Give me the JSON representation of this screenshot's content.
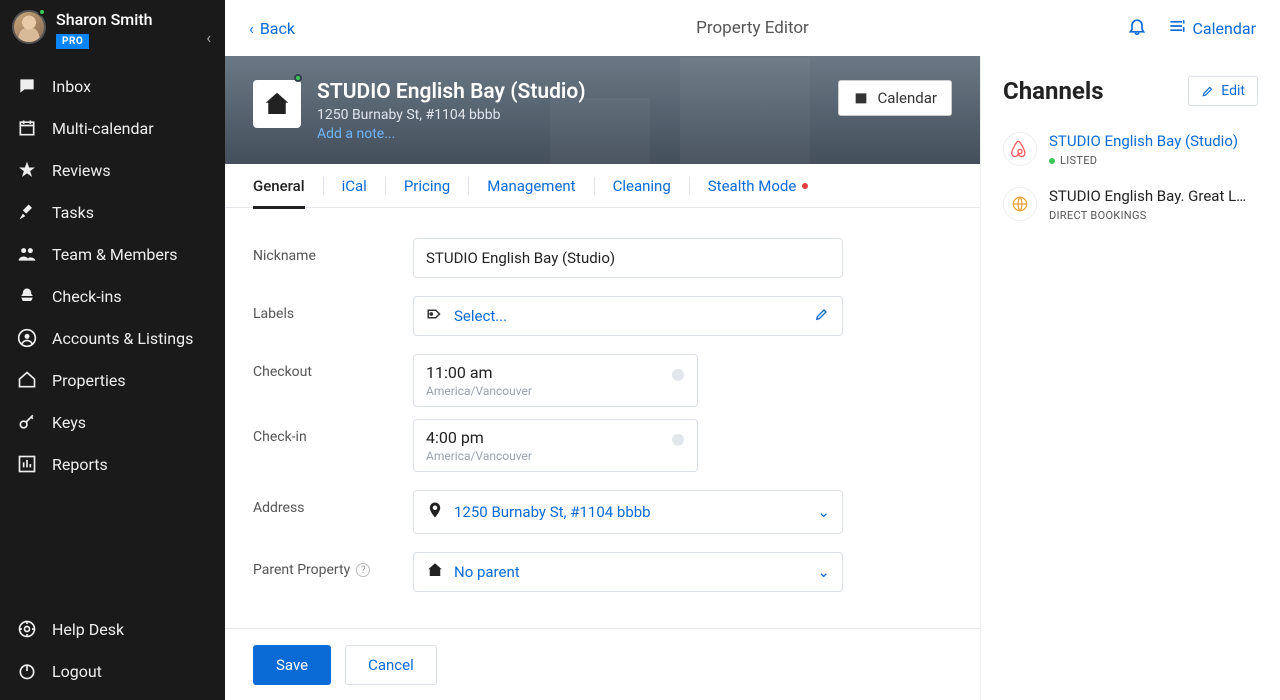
{
  "user": {
    "name": "Sharon Smith",
    "badge": "PRO"
  },
  "sidebar": {
    "items": [
      {
        "label": "Inbox"
      },
      {
        "label": "Multi-calendar"
      },
      {
        "label": "Reviews"
      },
      {
        "label": "Tasks"
      },
      {
        "label": "Team & Members"
      },
      {
        "label": "Check-ins"
      },
      {
        "label": "Accounts & Listings"
      },
      {
        "label": "Properties"
      },
      {
        "label": "Keys"
      },
      {
        "label": "Reports"
      }
    ],
    "bottom": [
      {
        "label": "Help Desk"
      },
      {
        "label": "Logout"
      }
    ]
  },
  "topbar": {
    "back": "Back",
    "title": "Property Editor",
    "calendar": "Calendar"
  },
  "hero": {
    "title": "STUDIO English Bay (Studio)",
    "subtitle": "1250 Burnaby St, #1104 bbbb",
    "note_link": "Add a note...",
    "calendar_btn": "Calendar"
  },
  "tabs": [
    "General",
    "iCal",
    "Pricing",
    "Management",
    "Cleaning",
    "Stealth Mode"
  ],
  "form": {
    "nickname_label": "Nickname",
    "nickname_value": "STUDIO English Bay (Studio)",
    "labels_label": "Labels",
    "labels_placeholder": "Select...",
    "checkout_label": "Checkout",
    "checkout_time": "11:00 am",
    "checkout_tz": "America/Vancouver",
    "checkin_label": "Check-in",
    "checkin_time": "4:00 pm",
    "checkin_tz": "America/Vancouver",
    "address_label": "Address",
    "address_value": "1250 Burnaby St, #1104 bbbb",
    "parent_label": "Parent Property",
    "parent_value": "No parent"
  },
  "footer": {
    "save": "Save",
    "cancel": "Cancel"
  },
  "channels": {
    "title": "Channels",
    "edit": "Edit",
    "items": [
      {
        "name": "STUDIO English Bay (Studio)",
        "status": "LISTED",
        "provider": "airbnb"
      },
      {
        "name": "STUDIO English Bay. Great L…",
        "status": "DIRECT BOOKINGS",
        "provider": "direct"
      }
    ]
  }
}
